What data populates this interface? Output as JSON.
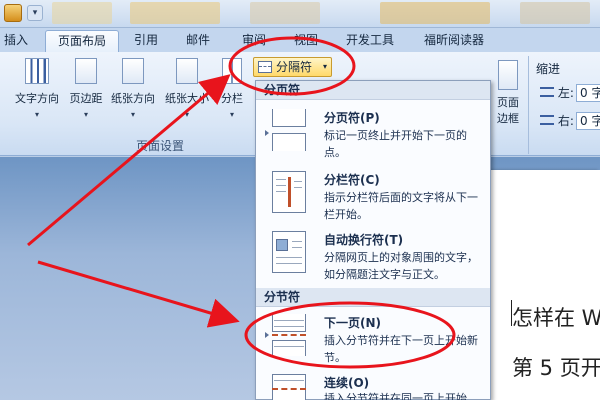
{
  "tabs": [
    "插入",
    "页面布局",
    "引用",
    "邮件",
    "审阅",
    "视图",
    "开发工具",
    "福昕阅读器"
  ],
  "active_tab_index": 1,
  "ribbon": {
    "buttons": [
      "文字方向",
      "页边距",
      "纸张方向",
      "纸张大小",
      "分栏"
    ],
    "group_label": "页面设置",
    "breaks_label": "分隔符",
    "right_buttons": [
      "页面",
      "边框"
    ],
    "indent": {
      "label": "缩进",
      "left_label": "左:",
      "left_value": "0 字",
      "right_label": "右:",
      "right_value": "0 字"
    }
  },
  "menu": {
    "section_page": "分页符",
    "section_section": "分节符",
    "items": [
      {
        "title": "分页符(P)",
        "desc": "标记一页终止并开始下一页的点。"
      },
      {
        "title": "分栏符(C)",
        "desc": "指示分栏符后面的文字将从下一栏开始。"
      },
      {
        "title": "自动换行符(T)",
        "desc": "分隔网页上的对象周围的文字，如分隔题注文字与正文。"
      },
      {
        "title": "下一页(N)",
        "desc": "插入分节符并在下一页上开始新节。"
      },
      {
        "title": "连续(O)",
        "desc": "插入分节符并在同一页上开始"
      }
    ]
  },
  "document": {
    "heading": "怎样在 W",
    "line2": "第 5 页开"
  },
  "colors": {
    "annotation_red": "#e8141c",
    "ribbon_bg": "#dbe8f7",
    "menu_header_bg": "#dde6f2",
    "highlight_button": "#ffd96a"
  }
}
